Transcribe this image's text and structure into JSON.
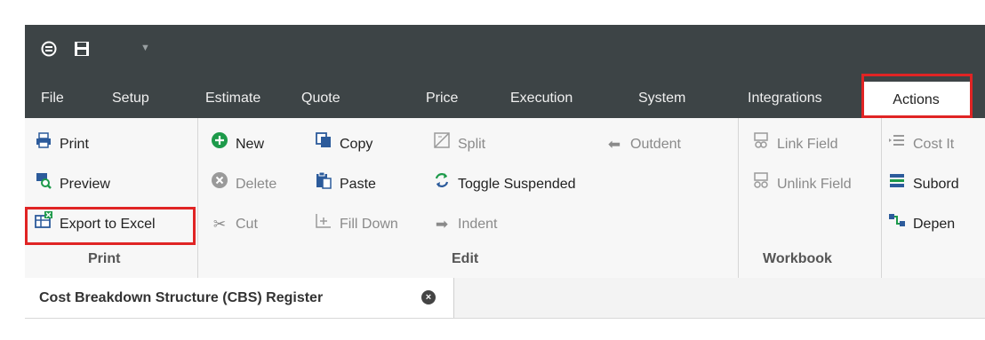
{
  "quick_access": {
    "logo_icon": "app-logo-icon",
    "save_icon": "save-icon",
    "dropdown_icon": "chevron-down-icon"
  },
  "menu": {
    "items": [
      "File",
      "Setup",
      "Estimate",
      "Quote",
      "Price",
      "Execution",
      "System",
      "Integrations",
      "Actions"
    ],
    "active": "Actions"
  },
  "ribbon": {
    "print_group": {
      "title": "Print",
      "print": "Print",
      "preview": "Preview",
      "export": "Export to Excel"
    },
    "edit_group": {
      "title": "Edit",
      "new": "New",
      "delete": "Delete",
      "cut": "Cut",
      "copy": "Copy",
      "paste": "Paste",
      "fill_down": "Fill Down",
      "split": "Split",
      "toggle_suspended": "Toggle Suspended",
      "indent": "Indent",
      "outdent": "Outdent"
    },
    "workbook_group": {
      "title": "Workbook",
      "link_field": "Link Field",
      "unlink_field": "Unlink Field"
    },
    "cost_group": {
      "cost_item": "Cost It",
      "subord": "Subord",
      "depen": "Depen"
    }
  },
  "doc_tab": {
    "label": "Cost Breakdown Structure (CBS) Register"
  },
  "colors": {
    "dark_bar": "#3d4446",
    "highlight": "#e02424"
  }
}
